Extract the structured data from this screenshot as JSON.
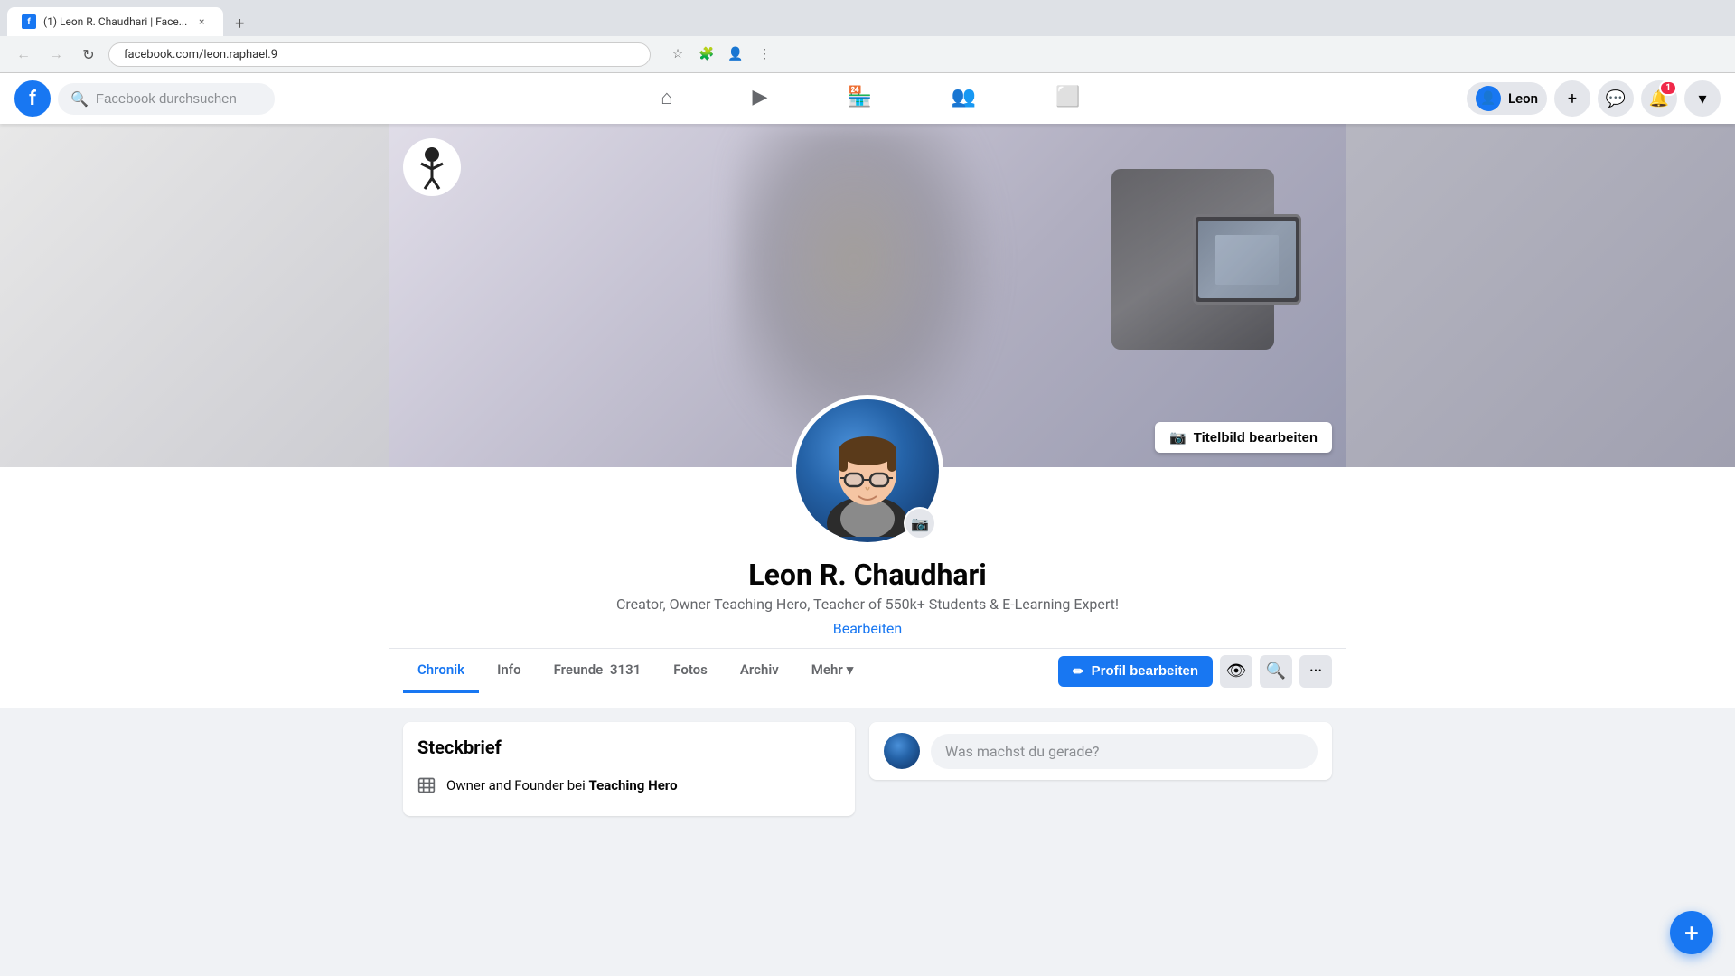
{
  "browser": {
    "tab_title": "(1) Leon R. Chaudhari | Face...",
    "url": "facebook.com/leon.raphael.9",
    "new_tab_label": "+"
  },
  "navbar": {
    "logo_letter": "f",
    "search_placeholder": "Facebook durchsuchen",
    "user_name": "Leon",
    "nav_items": [
      {
        "id": "home",
        "icon": "⌂"
      },
      {
        "id": "video",
        "icon": "▶"
      },
      {
        "id": "marketplace",
        "icon": "🏪"
      },
      {
        "id": "groups",
        "icon": "👥"
      },
      {
        "id": "gaming",
        "icon": "⬜"
      }
    ],
    "notification_count": "1"
  },
  "cover": {
    "edit_button_label": "Titelbild bearbeiten",
    "edit_icon": "📷"
  },
  "profile": {
    "name": "Leon R. Chaudhari",
    "bio": "Creator, Owner Teaching Hero, Teacher of 550k+ Students & E-Learning Expert!",
    "edit_link": "Bearbeiten",
    "tabs": [
      {
        "id": "chronik",
        "label": "Chronik",
        "active": true
      },
      {
        "id": "info",
        "label": "Info"
      },
      {
        "id": "freunde",
        "label": "Freunde",
        "count": "3131"
      },
      {
        "id": "fotos",
        "label": "Fotos"
      },
      {
        "id": "archiv",
        "label": "Archiv"
      },
      {
        "id": "mehr",
        "label": "Mehr",
        "has_dropdown": true
      }
    ],
    "actions": {
      "edit_profile_label": "Profil bearbeiten",
      "edit_profile_icon": "✏"
    }
  },
  "steckbrief": {
    "title": "Steckbrief",
    "items": [
      {
        "icon": "🏢",
        "text_prefix": "Owner and Founder bei ",
        "text_bold": "Teaching Hero"
      }
    ]
  },
  "post_box": {
    "placeholder": "Was machst du gerade?"
  },
  "fab": {
    "icon": "+"
  }
}
